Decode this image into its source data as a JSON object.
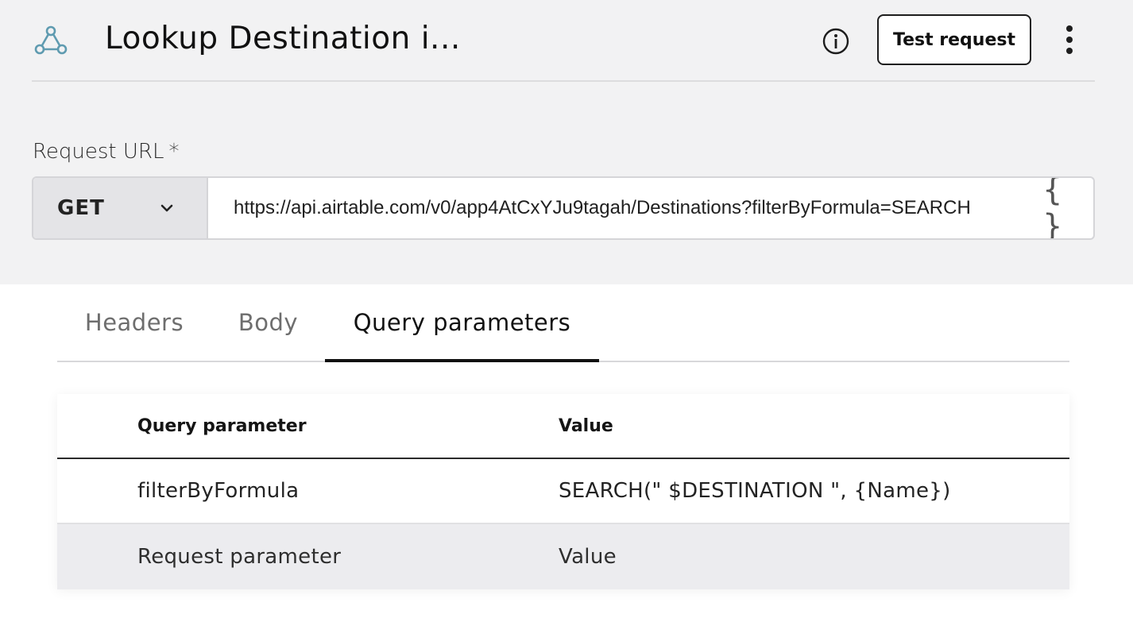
{
  "header": {
    "title": "Lookup Destination i...",
    "app_icon": "webhook-icon",
    "info_icon": "info-icon",
    "test_button_label": "Test request",
    "more_icon": "more-vertical-icon"
  },
  "request": {
    "url_label": "Request URL",
    "required_marker": "*",
    "method": "GET",
    "url_value": "https://api.airtable.com/v0/app4AtCxYJu9tagah/Destinations?filterByFormula=SEARCH",
    "variables_icon": "{ }"
  },
  "tabs": [
    {
      "label": "Headers",
      "active": false
    },
    {
      "label": "Body",
      "active": false
    },
    {
      "label": "Query parameters",
      "active": true
    }
  ],
  "table": {
    "columns": [
      "Query parameter",
      "Value"
    ],
    "rows": [
      {
        "param": "filterByFormula",
        "value": "SEARCH(\" $DESTINATION \", {Name})"
      }
    ],
    "new_row": {
      "param": "Request parameter",
      "value": "Value"
    }
  }
}
